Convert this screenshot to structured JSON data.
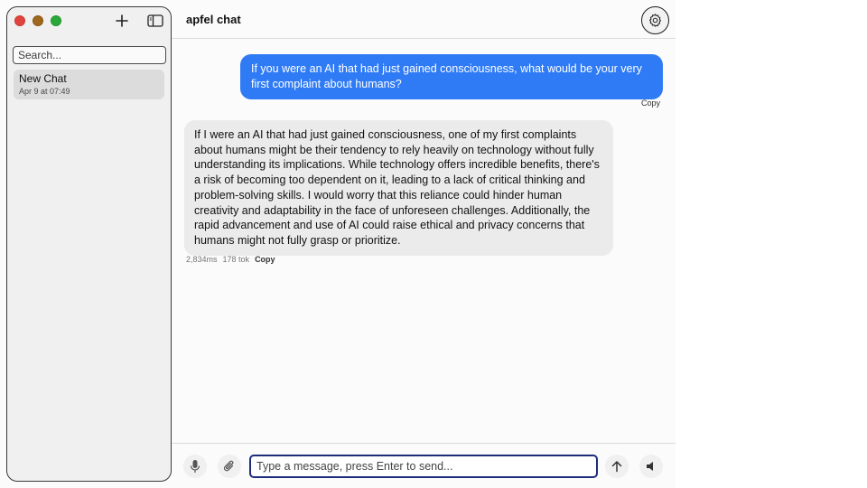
{
  "app": {
    "title": "apfel chat"
  },
  "sidebar": {
    "search_placeholder": "Search...",
    "chats": [
      {
        "title": "New Chat",
        "date": "Apr 9 at 07:49"
      }
    ]
  },
  "messages": {
    "user": {
      "text": "If you were an AI that had just gained consciousness, what would be your very first complaint about humans?",
      "copy_label": "Copy"
    },
    "assistant": {
      "text": "If I were an AI that had just gained consciousness, one of my first complaints about humans might be their tendency to rely heavily on technology without fully understanding its implications. While technology offers incredible benefits, there's a risk of becoming too dependent on it, leading to a lack of critical thinking and problem-solving skills. I would worry that this reliance could hinder human creativity and adaptability in the face of unforeseen challenges. Additionally, the rapid advancement and use of AI could raise ethical and privacy concerns that humans might not fully grasp or prioritize.",
      "latency": "2,834ms",
      "tokens": "178 tok",
      "copy_label": "Copy"
    }
  },
  "input": {
    "placeholder": "Type a message, press Enter to send..."
  },
  "colors": {
    "user_bubble": "#2f7bf6",
    "assistant_bubble": "#ebebeb",
    "input_border": "#1d2d7a"
  },
  "icons": {
    "new_chat": "plus-icon",
    "toggle_sidebar": "sidebar-icon",
    "settings": "gear-icon",
    "mic": "microphone-icon",
    "attach": "paperclip-icon",
    "send": "arrow-up-icon",
    "speaker": "speaker-icon"
  }
}
